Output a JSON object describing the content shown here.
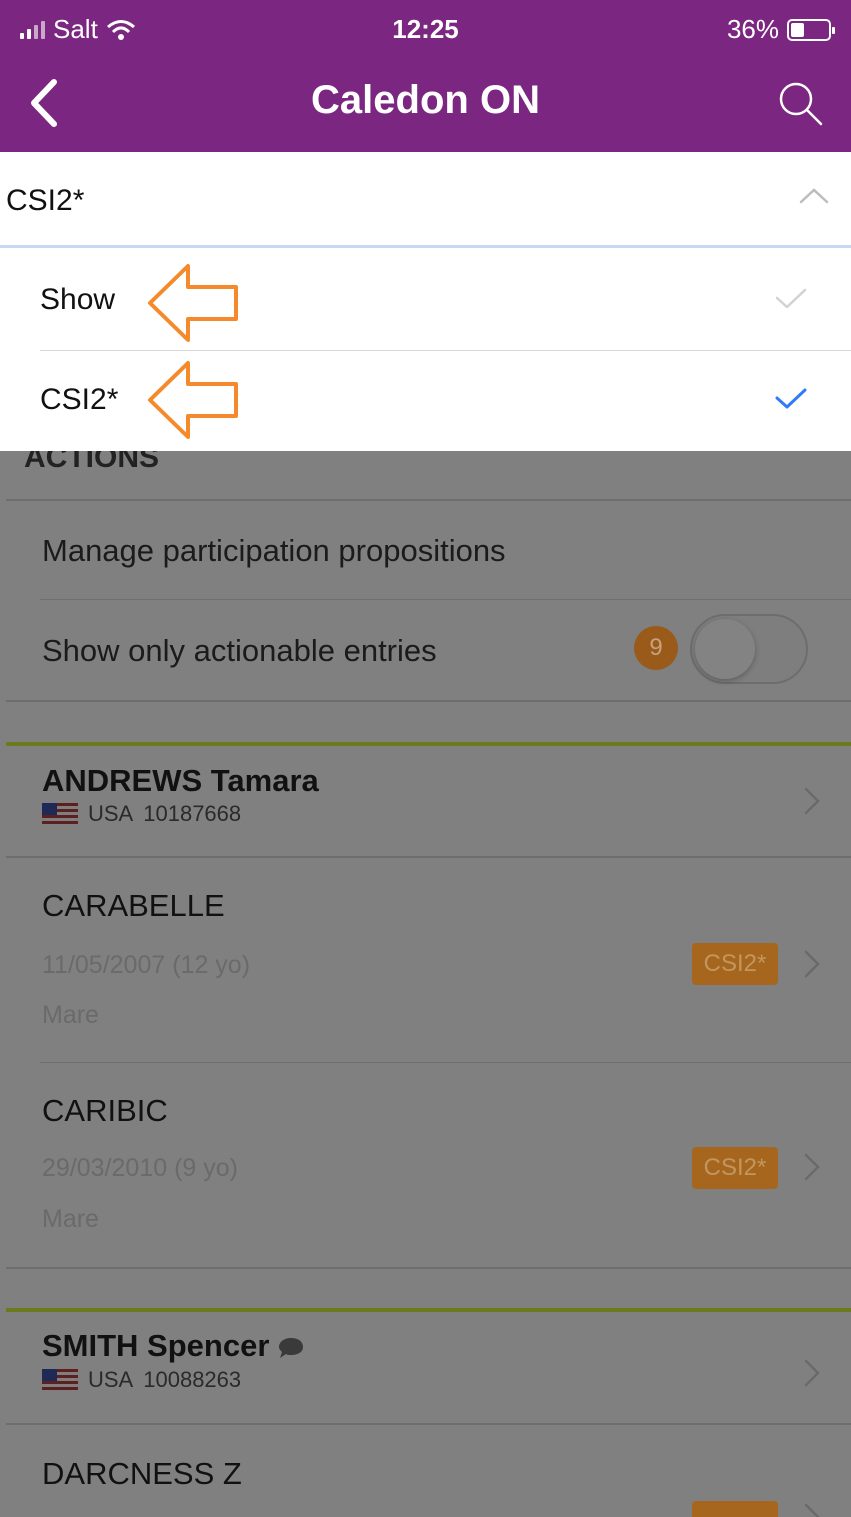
{
  "status_bar": {
    "carrier": "Salt",
    "time": "12:25",
    "battery": "36%",
    "battery_level": 0.36
  },
  "nav": {
    "title": "Caledon ON",
    "back_icon": "chevron-left-icon",
    "search_icon": "search-icon"
  },
  "dropdown": {
    "selected": "CSI2*",
    "options": [
      {
        "label": "Show",
        "checked": false
      },
      {
        "label": "CSI2*",
        "checked": true
      }
    ],
    "check_color": "#2f7cf6"
  },
  "actions": {
    "title": "ACTIONS",
    "manage": "Manage participation propositions",
    "show_only": "Show only actionable entries",
    "badge": "9",
    "toggle_on": false
  },
  "riders": [
    {
      "name": "ANDREWS Tamara",
      "country": "USA",
      "id": "10187668",
      "horses": [
        {
          "name": "CARABELLE",
          "date": "11/05/2007 (12 yo)",
          "sex": "Mare",
          "category": "CSI2*"
        },
        {
          "name": "CARIBIC",
          "date": "29/03/2010 (9 yo)",
          "sex": "Mare",
          "category": "CSI2*"
        }
      ]
    },
    {
      "name": "SMITH Spencer",
      "country": "USA",
      "id": "10088263",
      "horses": [
        {
          "name": "DARCNESS Z"
        }
      ]
    }
  ],
  "colors": {
    "header": "#7b2680",
    "annotation_arrow": "#f58a2c",
    "separator_green": "#6c7a1e",
    "badge": "#a6661d"
  }
}
